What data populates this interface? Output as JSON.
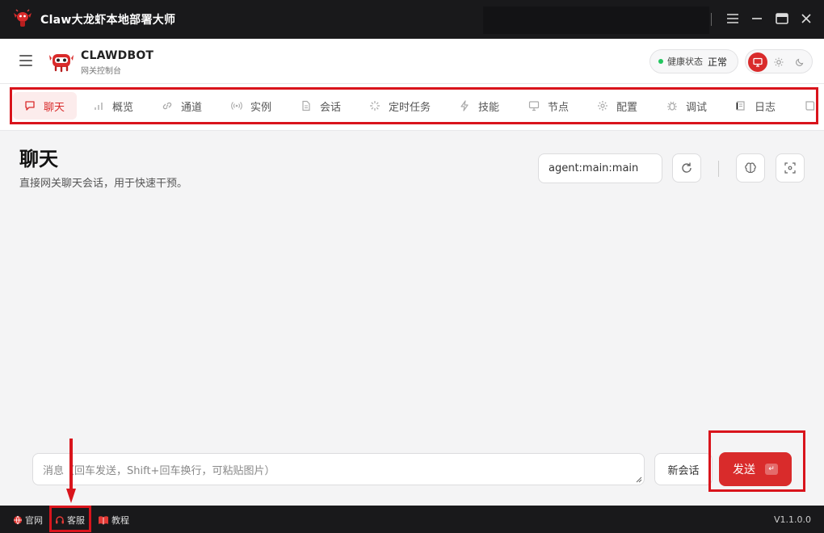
{
  "window": {
    "title": "Claw大龙虾本地部署大师"
  },
  "header": {
    "brand_name": "CLAWDBOT",
    "brand_sub": "网关控制台",
    "health_label": "健康状态",
    "health_value": "正常"
  },
  "tabs": [
    {
      "label": "聊天",
      "icon": "chat-bubble-icon",
      "active": true
    },
    {
      "label": "概览",
      "icon": "bar-chart-icon"
    },
    {
      "label": "通道",
      "icon": "link-icon"
    },
    {
      "label": "实例",
      "icon": "broadcast-icon"
    },
    {
      "label": "会话",
      "icon": "document-icon"
    },
    {
      "label": "定时任务",
      "icon": "loader-icon"
    },
    {
      "label": "技能",
      "icon": "bolt-icon"
    },
    {
      "label": "节点",
      "icon": "monitor-icon"
    },
    {
      "label": "配置",
      "icon": "gear-icon"
    },
    {
      "label": "调试",
      "icon": "bug-icon"
    },
    {
      "label": "日志",
      "icon": "log-icon"
    }
  ],
  "main": {
    "title": "聊天",
    "description": "直接网关聊天会话，用于快速干预。",
    "session_key": "agent:main:main",
    "message_placeholder": "消息（回车发送，Shift+回车换行，可粘贴图片）",
    "new_session_label": "新会话",
    "send_label": "发送",
    "send_key_hint": "↵"
  },
  "footer": {
    "website_label": "官网",
    "support_label": "客服",
    "tutorial_label": "教程",
    "version": "V1.1.0.0"
  },
  "colors": {
    "accent": "#d92b2b",
    "titlebar_bg": "#19191b",
    "status_ok": "#22c55e",
    "annotation": "#d9141c"
  }
}
